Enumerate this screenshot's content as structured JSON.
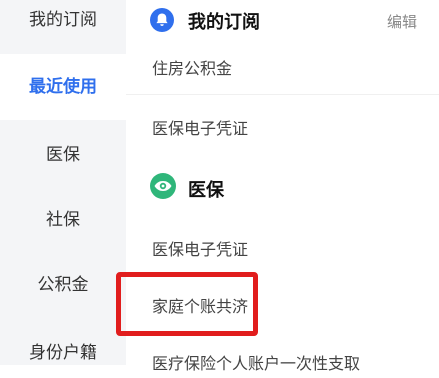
{
  "sidebar": {
    "items": [
      {
        "label": "我的订阅",
        "active": false
      },
      {
        "label": "最近使用",
        "active": true
      },
      {
        "label": "医保",
        "active": false
      },
      {
        "label": "社保",
        "active": false
      },
      {
        "label": "公积金",
        "active": false
      },
      {
        "label": "身份户籍",
        "active": false
      }
    ]
  },
  "main": {
    "subscription": {
      "title": "我的订阅",
      "edit_label": "编辑",
      "icon": "bell-icon",
      "items": [
        "住房公积金",
        "医保电子凭证"
      ]
    },
    "medical": {
      "title": "医保",
      "icon": "eye-shield-icon",
      "items": [
        "医保电子凭证",
        "家庭个账共济",
        "医疗保险个人账户一次性支取"
      ]
    }
  },
  "colors": {
    "accent": "#2f6fed",
    "medical_icon": "#2fb67a",
    "highlight": "#e11d1d",
    "sidebar_bg": "#f4f5f7"
  }
}
